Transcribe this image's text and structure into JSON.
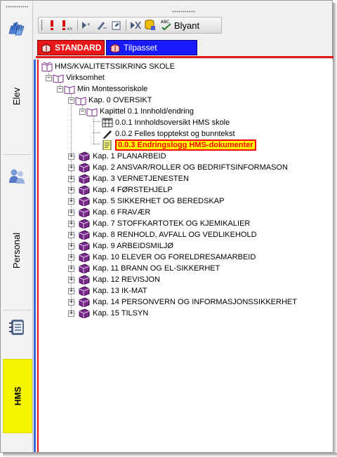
{
  "nav": {
    "tabs": [
      {
        "label": "Elev"
      },
      {
        "label": "Personal"
      },
      {
        "label": "HMS"
      }
    ]
  },
  "toolbar": {
    "blyant_label": "Blyant",
    "spell_badge": "ABC"
  },
  "tabs": {
    "standard": "STANDARD",
    "tilpasset": "Tilpasset"
  },
  "tree": {
    "root": "HMS/KVALITETSSIKRING  SKOLE",
    "virksomhet": "Virksomhet",
    "skole": "Min Montessoriskole",
    "kap0": "Kap. 0  OVERSIKT",
    "kap01": "Kapittel 0.1 Innhold/endring",
    "doc1": "0.0.1 Innholdsoversikt HMS skole",
    "doc2": "0.0.2 Felles topptekst og bunntekst",
    "doc3": "0.0.3 Endringslogg HMS-dokumenter",
    "chapters": [
      "Kap. 1   PLANARBEID",
      "Kap. 2  ANSVAR/ROLLER OG BEDRIFTSINFORMASON",
      "Kap. 3   VERNETJENESTEN",
      "Kap. 4   FØRSTEHJELP",
      "Kap. 5  SIKKERHET OG BEREDSKAP",
      "Kap. 6  FRAVÆR",
      "Kap. 7    STOFFKARTOTEK OG KJEMIKALIER",
      "Kap. 8   RENHOLD, AVFALL  OG VEDLIKEHOLD",
      "Kap. 9   ARBEIDSMILJØ",
      "Kap. 10 ELEVER OG FORELDRESAMARBEID",
      "Kap. 11 BRANN OG EL-SIKKERHET",
      "Kap. 12 REVISJON",
      "Kap. 13 IK-MAT",
      "Kap. 14  PERSONVERN OG INFORMASJONSSIKKERHET",
      "Kap. 15 TILSYN"
    ]
  },
  "colors": {
    "accent_red": "#e81818",
    "accent_blue": "#1a1aff",
    "active_nav": "#f5f500",
    "book_purple": "#7a2a8a"
  }
}
